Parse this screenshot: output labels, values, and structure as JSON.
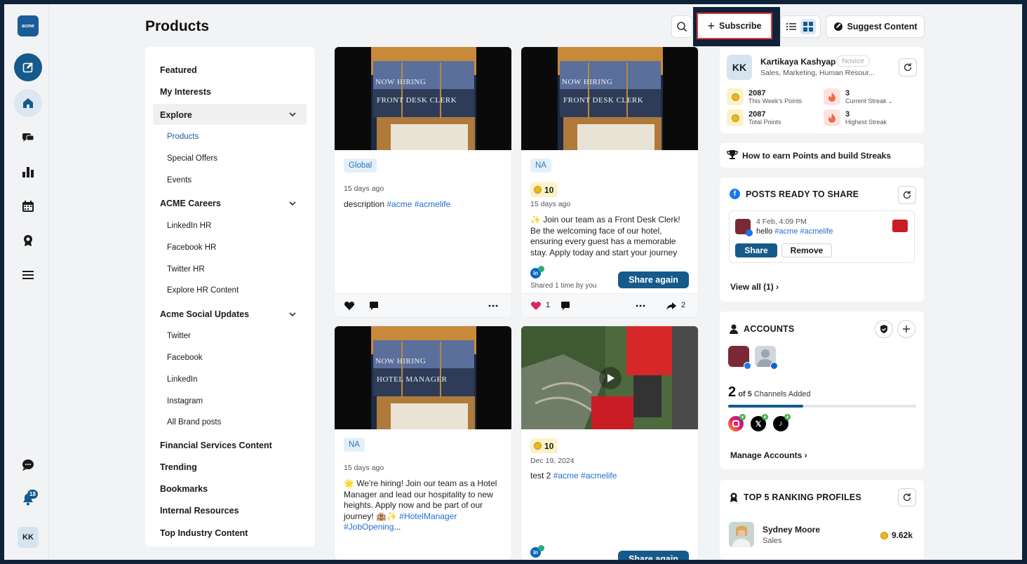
{
  "app": {
    "logo_text": "acme",
    "notification_count": "18",
    "user_initials": "KK"
  },
  "page": {
    "title": "Products"
  },
  "topbar": {
    "subscribe_label": "Subscribe",
    "suggest_label": "Suggest Content"
  },
  "leftnav": {
    "featured": "Featured",
    "my_interests": "My Interests",
    "explore": "Explore",
    "explore_items": [
      "Products",
      "Special Offers",
      "Events"
    ],
    "careers": "ACME Careers",
    "careers_items": [
      "LinkedIn HR",
      "Facebook HR",
      "Twitter HR",
      "Explore HR Content"
    ],
    "social": "Acme Social Updates",
    "social_items": [
      "Twitter",
      "Facebook",
      "LinkedIn",
      "Instagram",
      "All Brand posts"
    ],
    "financial": "Financial Services Content",
    "trending": "Trending",
    "bookmarks": "Bookmarks",
    "internal": "Internal Resources",
    "industry": "Top Industry Content"
  },
  "cards": [
    {
      "img_line1": "NOW HIRING",
      "img_line2": "FRONT DESK CLERK",
      "tag": "Global",
      "ago": "15 days ago",
      "text_prefix": "description ",
      "hashtags": "#acme #acmelife"
    },
    {
      "img_line1": "NOW HIRING",
      "img_line2": "FRONT DESK CLERK",
      "tag": "NA",
      "points": "10",
      "ago": "15 days ago",
      "text": "✨ Join our team as a Front Desk Clerk! Be the welcoming face of our hotel, ensuring every guest has a memorable stay. Apply today and start your journey",
      "shared": "Shared 1 time by you",
      "share_again": "Share again",
      "likes": "1",
      "shares": "2"
    },
    {
      "img_line1": "NOW HIRING",
      "img_line2": "HOTEL MANAGER",
      "tag": "NA",
      "ago": "15 days ago",
      "text": "🌟 We're hiring! Join our team as a Hotel Manager and lead our hospitality to new heights. Apply now and be part of our journey! 🏨✨",
      "hashtag1": "#HotelManager",
      "hashtag2": "#JobOpening",
      "ellipsis": "..."
    },
    {
      "points": "10",
      "ago": "Dec 19, 2024",
      "text_prefix": "test 2 ",
      "hashtags": "#acme #acmelife",
      "share_again": "Share again"
    }
  ],
  "profile": {
    "initials": "KK",
    "name": "Kartikaya Kashyap",
    "level": "Novice",
    "roles": "Sales, Marketing, Human Resour...",
    "week_points": "2087",
    "week_points_label": "This Week's Points",
    "current_streak": "3",
    "current_streak_label": "Current Streak",
    "total_points": "2087",
    "total_points_label": "Total Points",
    "highest_streak": "3",
    "highest_streak_label": "Highest Streak"
  },
  "earn": {
    "label": "How to earn Points and build Streaks"
  },
  "ready": {
    "title": "POSTS READY TO SHARE",
    "date": "4 Feb, 4:09 PM",
    "text_prefix": "hello ",
    "hashtags": "#acme #acmelife",
    "share": "Share",
    "remove": "Remove",
    "view_all": "View all (1)"
  },
  "accounts": {
    "title": "ACCOUNTS",
    "count": "2",
    "of_text": "of 5",
    "channels_added": "Channels Added",
    "progress": 0.4,
    "manage": "Manage Accounts"
  },
  "ranking": {
    "title": "TOP 5 RANKING PROFILES",
    "name": "Sydney Moore",
    "dept": "Sales",
    "points": "9.62k"
  },
  "colors": {
    "primary": "#155a8a",
    "accent": "#1f6fd1",
    "highlight": "#e53935"
  }
}
